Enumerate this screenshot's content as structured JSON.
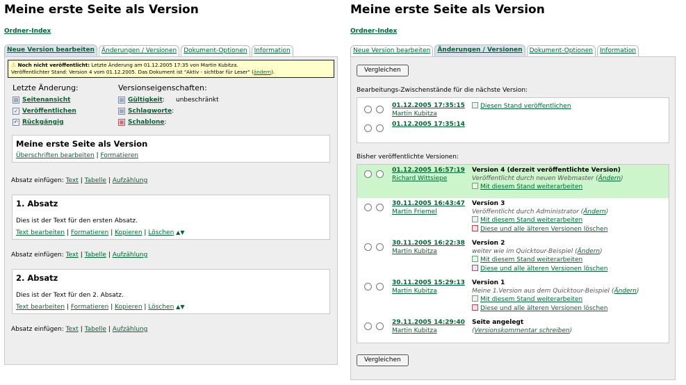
{
  "left": {
    "title": "Meine erste Seite als Version",
    "ordner_index": "Ordner-Index",
    "tabs": [
      "Neue Version bearbeiten",
      "Änderungen / Versionen",
      "Dokument-Optionen",
      "Information"
    ],
    "warning": {
      "bold": "Noch nicht veröffentlicht:",
      "line1": " Letzte Änderung am 01.12.2005 17:35 von Martin Kubitza.",
      "line2": "Veröffentlichter Stand: Version 4 vom 01.12.2005.    Das Dokument ist \"Aktiv - sichtbar für Leser\" (",
      "link": "ändern",
      "line2_end": ")."
    },
    "last_change": {
      "heading": "Letzte Änderung:",
      "items": [
        "Seitenansicht",
        "Veröffentlichen",
        "Rückgängig"
      ]
    },
    "version_props": {
      "heading": "Versionseigenschaften:",
      "items": [
        {
          "label": "Gültigkeit",
          "value": "unbeschränkt"
        },
        {
          "label": "Schlagworte",
          "value": ""
        },
        {
          "label": "Schablone",
          "value": ""
        }
      ]
    },
    "title_box": {
      "heading": "Meine erste Seite als Version",
      "action1": "Überschriften bearbeiten",
      "action2": "Formatieren"
    },
    "insert": {
      "label": "Absatz einfügen:",
      "text": "Text",
      "table": "Tabelle",
      "list": "Aufzählung"
    },
    "paragraphs": [
      {
        "heading": "1. Absatz",
        "text": "Dies ist der Text für den ersten Absatz."
      },
      {
        "heading": "2. Absatz",
        "text": "Dies ist der Text für den 2. Absatz."
      }
    ],
    "para_actions": {
      "edit": "Text bearbeiten",
      "format": "Formatieren",
      "copy": "Kopieren",
      "delete": "Löschen"
    }
  },
  "right": {
    "title": "Meine erste Seite als Version",
    "ordner_index": "Ordner-Index",
    "tabs": [
      "Neue Version bearbeiten",
      "Änderungen / Versionen",
      "Dokument-Optionen",
      "Information"
    ],
    "compare_label": "Vergleichen",
    "drafts_heading": "Bearbeitungs-Zwischenstände für die nächste Version:",
    "drafts": [
      {
        "date": "01.12.2005 17:35:15",
        "user": "Martin Kubitza",
        "action": "Diesen Stand veröffentlichen"
      },
      {
        "date": "01.12.2005 17:35:14",
        "user": "",
        "action": ""
      }
    ],
    "published_heading": "Bisher veröffentlichte Versionen:",
    "versions": [
      {
        "date": "01.12.2005 16:57:19",
        "user": "Richard Wittsiepe",
        "title": "Version 4 (derzeit veröffentlichte Version)",
        "note": "Veröffentlicht durch neuen Webmaster (",
        "note_link": "Ändern",
        "continue": "Mit diesem Stand weiterarbeiten",
        "delete": ""
      },
      {
        "date": "30.11.2005 16:43:47",
        "user": "Martin Friemel",
        "title": "Version 3",
        "note": "Veröffentlicht durch Administrator (",
        "note_link": "Ändern",
        "continue": "Mit diesem Stand weiterarbeiten",
        "delete": "Diese und alle älteren Versionen löschen"
      },
      {
        "date": "30.11.2005 16:22:38",
        "user": "Martin Kubitza",
        "title": "Version 2",
        "note": "weiter wie im Quicktour-Beispiel (",
        "note_link": "Ändern",
        "continue": "Mit diesem Stand weiterarbeiten",
        "delete": "Diese und alle älteren Versionen löschen"
      },
      {
        "date": "30.11.2005 15:29:13",
        "user": "Martin Kubitza",
        "title": "Version 1",
        "note": "Meine 1.Version aus dem Quicktour-Beispiel (",
        "note_link": "Ändern",
        "continue": "Mit diesem Stand weiterarbeiten",
        "delete": "Diese und alle älteren Versionen löschen"
      },
      {
        "date": "29.11.2005 14:29:40",
        "user": "Martin Kubitza",
        "title": "Seite angelegt",
        "note": "(",
        "note_link": "Versionskommentar schreiben",
        "continue": "",
        "delete": ""
      }
    ],
    "highlight_color": "#ccf5cc"
  }
}
